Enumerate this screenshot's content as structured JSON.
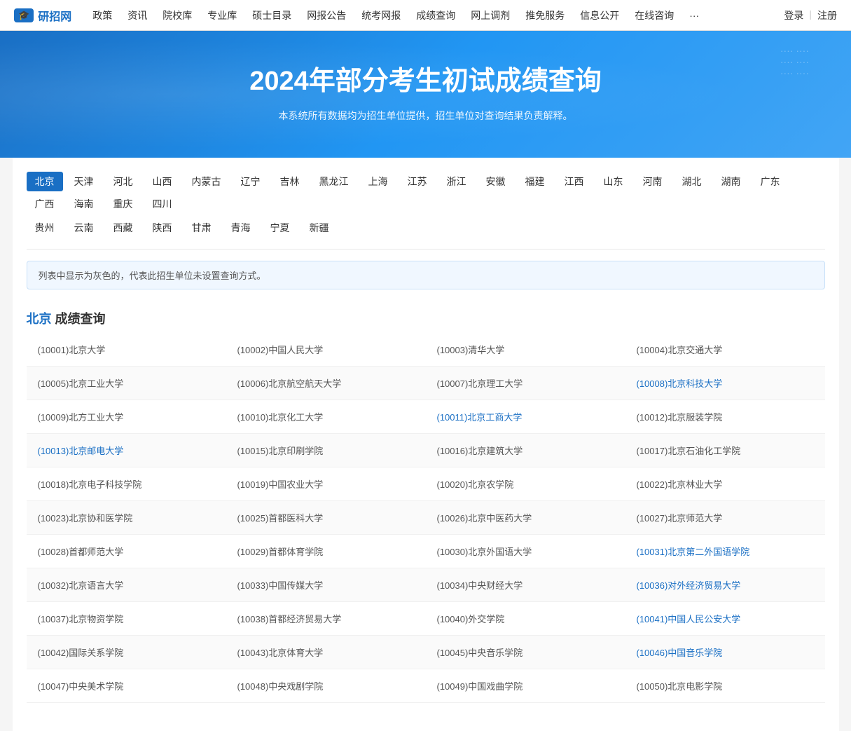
{
  "nav": {
    "logo_text": "研招网",
    "logo_icon": "🎓",
    "links": [
      "政策",
      "资讯",
      "院校库",
      "专业库",
      "硕士目录",
      "网报公告",
      "统考网报",
      "成绩查询",
      "网上调剂",
      "推免服务",
      "信息公开",
      "在线咨询",
      "···"
    ],
    "auth": [
      "登录",
      "|",
      "注册"
    ]
  },
  "hero": {
    "title": "2024年部分考生初试成绩查询",
    "subtitle": "本系统所有数据均为招生单位提供，招生单位对查询结果负责解释。"
  },
  "provinces_row1": [
    "北京",
    "天津",
    "河北",
    "山西",
    "内蒙古",
    "辽宁",
    "吉林",
    "黑龙江",
    "上海",
    "江苏",
    "浙江",
    "安徽",
    "福建",
    "江西",
    "山东",
    "河南",
    "湖北",
    "湖南",
    "广东",
    "广西",
    "海南",
    "重庆",
    "四川"
  ],
  "provinces_row2": [
    "贵州",
    "云南",
    "西藏",
    "陕西",
    "甘肃",
    "青海",
    "宁夏",
    "新疆"
  ],
  "active_province": "北京",
  "info_text": "列表中显示为灰色的，代表此招生单位未设置查询方式。",
  "section_region": "北京",
  "section_label": " 成绩查询",
  "schools": [
    [
      "(10001)北京大学",
      "(10002)中国人民大学",
      "(10003)清华大学",
      "(10004)北京交通大学"
    ],
    [
      "(10005)北京工业大学",
      "(10006)北京航空航天大学",
      "(10007)北京理工大学",
      "(10008)北京科技大学"
    ],
    [
      "(10009)北方工业大学",
      "(10010)北京化工大学",
      "(10011)北京工商大学",
      "(10012)北京服装学院"
    ],
    [
      "(10013)北京邮电大学",
      "(10015)北京印刷学院",
      "(10016)北京建筑大学",
      "(10017)北京石油化工学院"
    ],
    [
      "(10018)北京电子科技学院",
      "(10019)中国农业大学",
      "(10020)北京农学院",
      "(10022)北京林业大学"
    ],
    [
      "(10023)北京协和医学院",
      "(10025)首都医科大学",
      "(10026)北京中医药大学",
      "(10027)北京师范大学"
    ],
    [
      "(10028)首都师范大学",
      "(10029)首都体育学院",
      "(10030)北京外国语大学",
      "(10031)北京第二外国语学院"
    ],
    [
      "(10032)北京语言大学",
      "(10033)中国传媒大学",
      "(10034)中央财经大学",
      "(10036)对外经济贸易大学"
    ],
    [
      "(10037)北京物资学院",
      "(10038)首都经济贸易大学",
      "(10040)外交学院",
      "(10041)中国人民公安大学"
    ],
    [
      "(10042)国际关系学院",
      "(10043)北京体育大学",
      "(10045)中央音乐学院",
      "(10046)中国音乐学院"
    ],
    [
      "(10047)中央美术学院",
      "(10048)中央戏剧学院",
      "(10049)中国戏曲学院",
      "(10050)北京电影学院"
    ]
  ],
  "school_links": {
    "1_3": true,
    "2_2": true,
    "3_0": true,
    "6_3": true,
    "7_3": true,
    "8_3": true,
    "9_3": true
  }
}
